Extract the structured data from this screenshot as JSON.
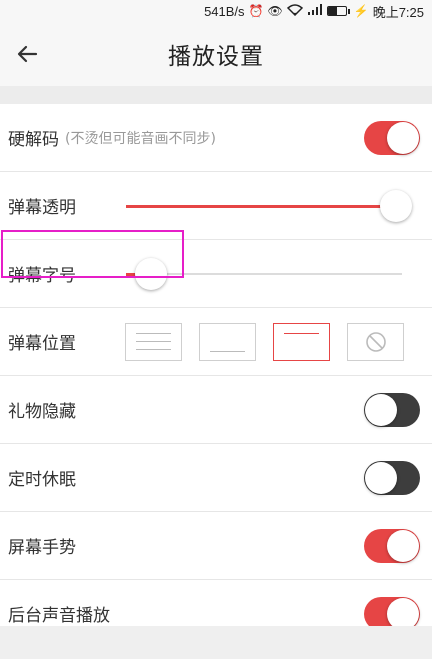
{
  "status_bar": {
    "net_speed": "541B/s",
    "icons": [
      "alarm-icon",
      "eye-icon",
      "wifi-icon",
      "signal-icon",
      "battery-icon",
      "charging-icon"
    ],
    "signal_label": "4G",
    "battery_level": "49",
    "time": "晚上7:25"
  },
  "header": {
    "title": "播放设置",
    "back_icon": "arrow-left-icon"
  },
  "colors": {
    "accent": "#e64545",
    "toggle_off": "#3d3d3d",
    "highlight": "#e61ec8"
  },
  "settings": {
    "hardware_decode": {
      "label": "硬解码",
      "hint": "(不烫但可能音画不同步)",
      "on": true
    },
    "danmaku_opacity": {
      "label": "弹幕透明",
      "value_percent": 98
    },
    "danmaku_font_size": {
      "label": "弹幕字号",
      "value_percent": 9
    },
    "danmaku_position": {
      "label": "弹幕位置",
      "options": [
        "full-screen-icon",
        "bottom-icon",
        "top-icon",
        "disable-icon"
      ],
      "selected_index": 2
    },
    "hide_gifts": {
      "label": "礼物隐藏",
      "on": false
    },
    "sleep_timer": {
      "label": "定时休眠",
      "on": false
    },
    "screen_gestures": {
      "label": "屏幕手势",
      "on": true
    },
    "background_audio": {
      "label": "后台声音播放",
      "on": true
    }
  }
}
